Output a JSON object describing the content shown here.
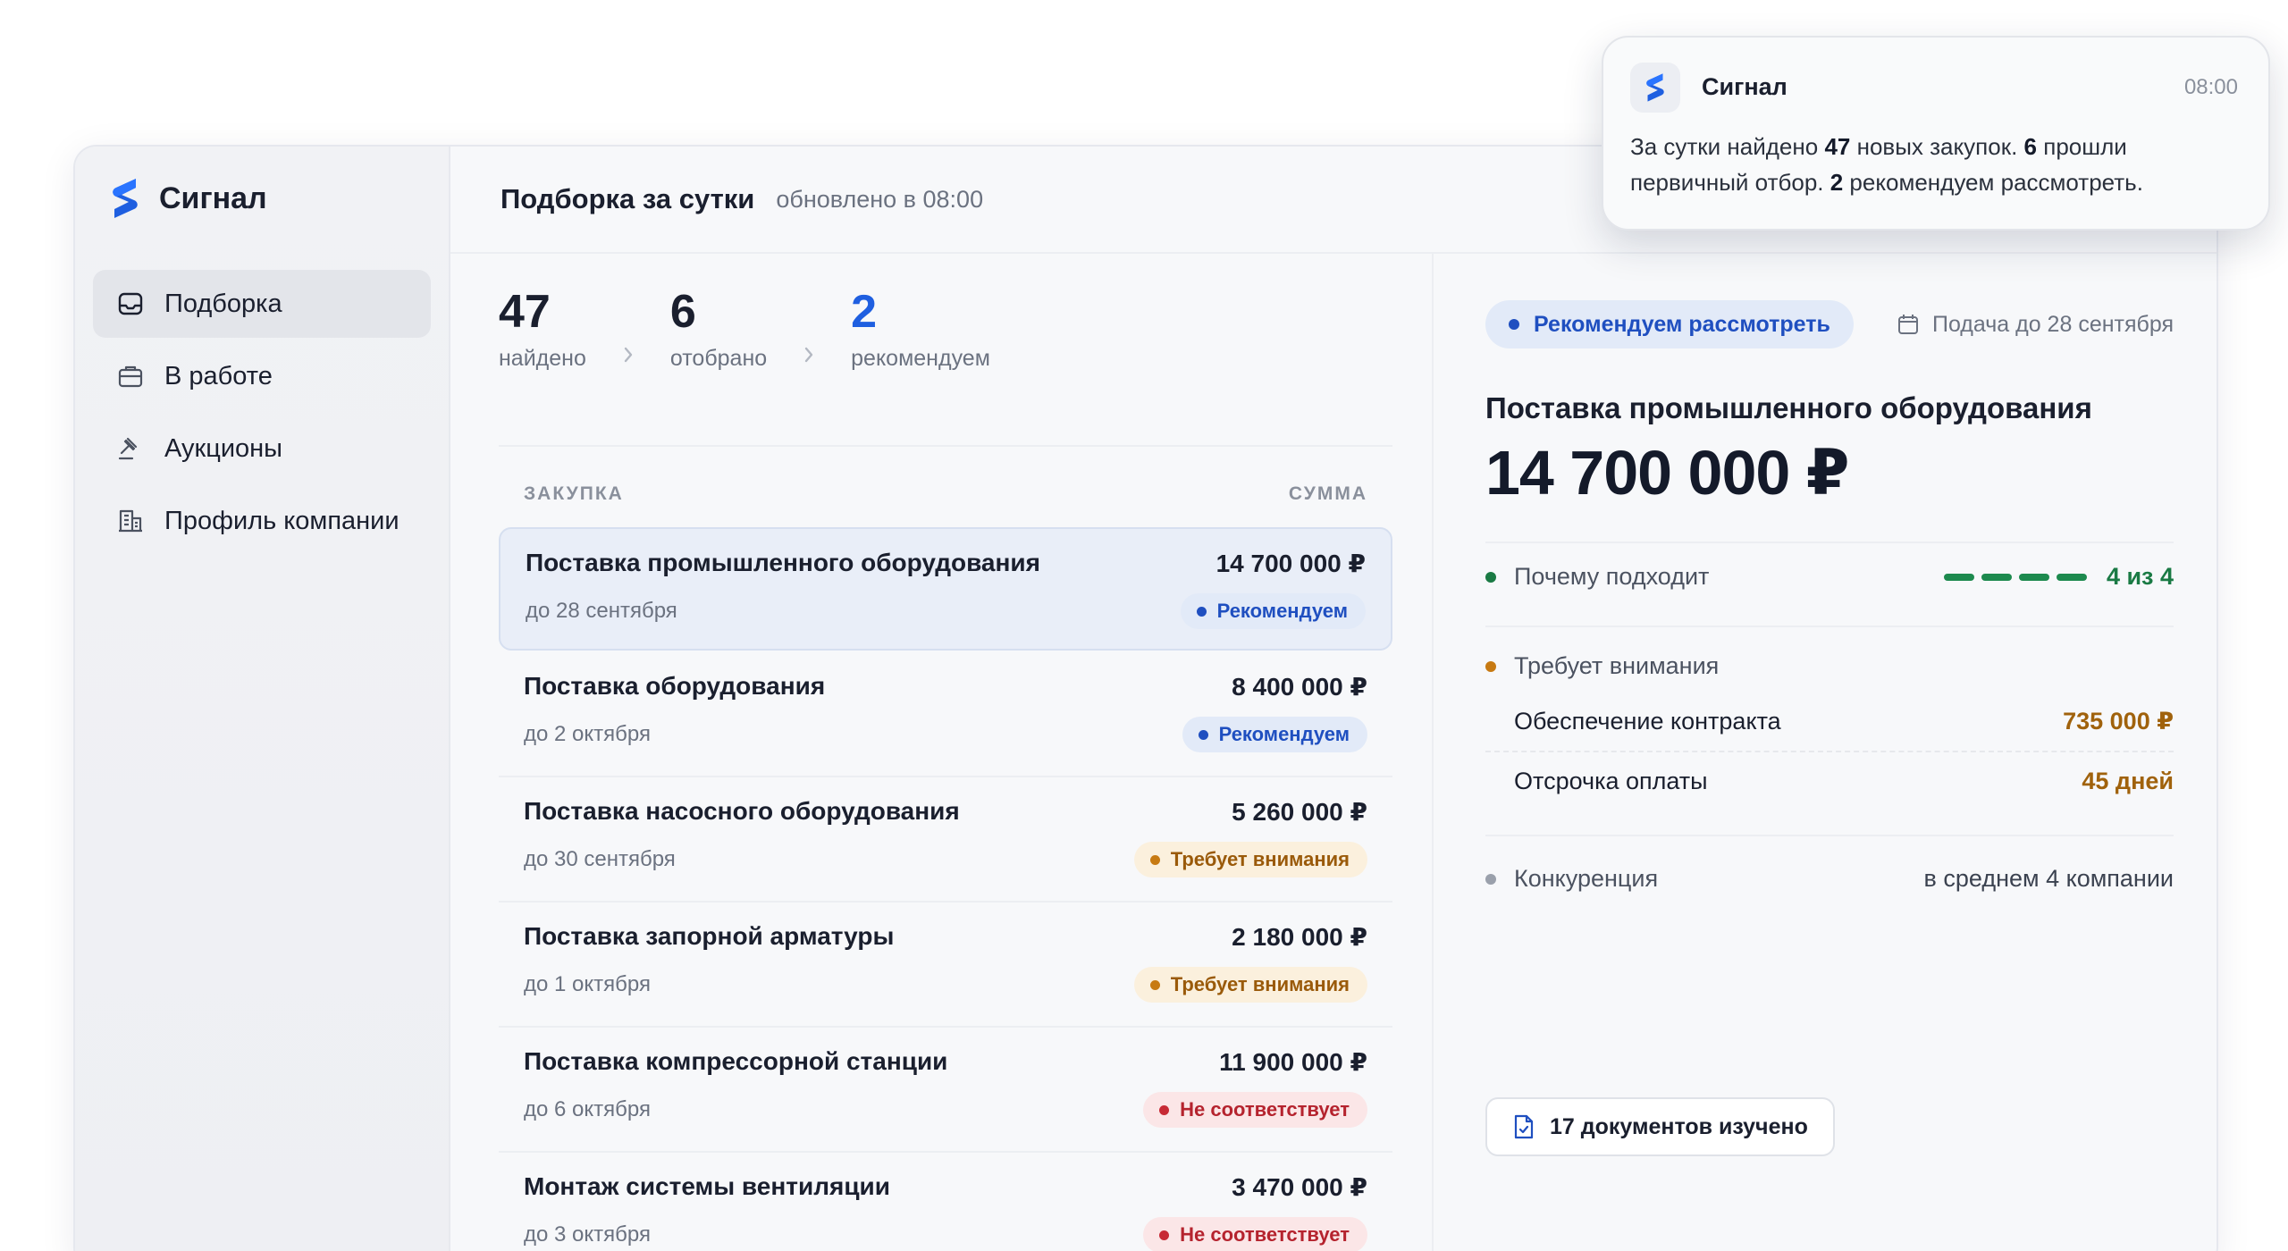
{
  "app": {
    "name": "Сигнал"
  },
  "sidebar": {
    "items": [
      {
        "label": "Подборка",
        "icon": "inbox-icon",
        "active": true
      },
      {
        "label": "В работе",
        "icon": "briefcase-icon",
        "active": false
      },
      {
        "label": "Аукционы",
        "icon": "gavel-icon",
        "active": false
      },
      {
        "label": "Профиль компании",
        "icon": "building-icon",
        "active": false
      }
    ]
  },
  "header": {
    "title": "Подборка за сутки",
    "updated": "обновлено в 08:00"
  },
  "stats": [
    {
      "value": "47",
      "label": "найдено"
    },
    {
      "value": "6",
      "label": "отобрано"
    },
    {
      "value": "2",
      "label": "рекомендуем"
    }
  ],
  "list": {
    "col_name": "ЗАКУПКА",
    "col_sum": "СУММА",
    "rows": [
      {
        "name": "Поставка промышленного оборудования",
        "date": "до 28 сентября",
        "sum": "14 700 000 ₽",
        "status": "Рекомендуем",
        "kind": "rec"
      },
      {
        "name": "Поставка оборудования",
        "date": "до 2 октября",
        "sum": "8 400 000 ₽",
        "status": "Рекомендуем",
        "kind": "rec"
      },
      {
        "name": "Поставка насосного оборудования",
        "date": "до 30 сентября",
        "sum": "5 260 000 ₽",
        "status": "Требует внимания",
        "kind": "att"
      },
      {
        "name": "Поставка запорной арматуры",
        "date": "до 1 октября",
        "sum": "2 180 000 ₽",
        "status": "Требует внимания",
        "kind": "att"
      },
      {
        "name": "Поставка компрессорной станции",
        "date": "до 6 октября",
        "sum": "11 900 000 ₽",
        "status": "Не соответствует",
        "kind": "bad"
      },
      {
        "name": "Монтаж системы вентиляции",
        "date": "до 3 октября",
        "sum": "3 470 000 ₽",
        "status": "Не соответствует",
        "kind": "bad"
      }
    ]
  },
  "detail": {
    "badge": "Рекомендуем рассмотреть",
    "deadline": "Подача до 28 сентября",
    "name": "Поставка промышленного оборудования",
    "sum": "14 700 000 ₽",
    "why_label": "Почему подходит",
    "why_score": "4 из 4",
    "why_filled": 4,
    "why_total": 4,
    "attention_label": "Требует внимания",
    "security_label": "Обеспечение контракта",
    "security_value": "735 000 ₽",
    "delay_label": "Отсрочка оплаты",
    "delay_value": "45 дней",
    "competition_label": "Конкуренция",
    "competition_value": "в среднем 4 компании",
    "docs_button": "17 документов изучено"
  },
  "notification": {
    "app": "Сигнал",
    "time": "08:00",
    "t1": "За сутки найдено ",
    "b1": "47",
    "t2": " новых закупок. ",
    "b2": "6",
    "t3": " прошли первичный отбор. ",
    "b3": "2",
    "t4": " рекомендуем рассмотреть."
  },
  "colors": {
    "accent": "#1f5fe0",
    "recommend": "#1f4fc0",
    "attention": "#a0620c",
    "mismatch": "#b5232e",
    "positive": "#1a7a44"
  }
}
